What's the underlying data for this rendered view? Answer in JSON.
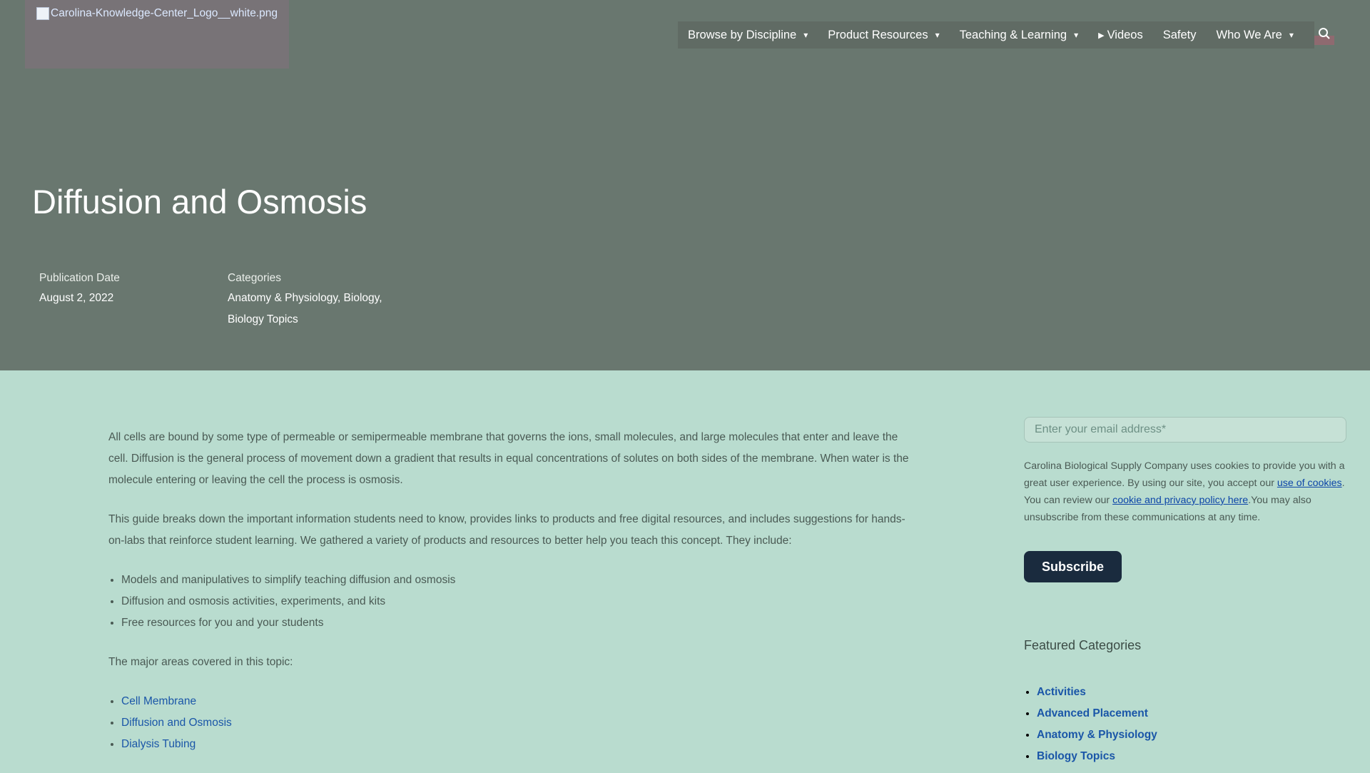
{
  "header": {
    "logo_alt": "Carolina-Knowledge-Center_Logo__white.png",
    "nav": [
      {
        "label": "Browse by Discipline",
        "has_dropdown": true
      },
      {
        "label": "Product Resources",
        "has_dropdown": true
      },
      {
        "label": "Teaching & Learning",
        "has_dropdown": true
      },
      {
        "label": "Videos",
        "has_dropdown": false,
        "icon": "play-icon"
      },
      {
        "label": "Safety",
        "has_dropdown": false
      },
      {
        "label": "Who We Are",
        "has_dropdown": true
      }
    ],
    "search_icon": "search-icon"
  },
  "hero": {
    "title": "Diffusion and Osmosis",
    "publication_date_label": "Publication Date",
    "publication_date": "August 2, 2022",
    "categories_label": "Categories",
    "categories_line1": "Anatomy & Physiology, Biology,",
    "categories_line2": "Biology Topics"
  },
  "article": {
    "p1": "All cells are bound by some type of permeable or semipermeable membrane that governs the ions, small molecules, and large molecules that enter and leave the cell. Diffusion is the general process of movement down a gradient that results in equal concentrations of solutes on both sides of the membrane. When water is the molecule entering or leaving the cell the process is osmosis.",
    "p2": "This guide breaks down the important information students need to know, provides links to products and free digital resources, and includes suggestions for hands-on-labs that reinforce student learning. We gathered a variety of products and resources to better help you teach this concept. They include:",
    "list1": [
      "Models and manipulatives to simplify teaching diffusion and osmosis",
      "Diffusion and osmosis activities, experiments, and kits",
      "Free resources for you and your students"
    ],
    "p3": "The major areas covered in this topic:",
    "topics": [
      "Cell Membrane",
      "Diffusion and Osmosis",
      "Dialysis Tubing"
    ]
  },
  "sidebar": {
    "email_placeholder": "Enter your email address*",
    "cookie_text_1": "Carolina Biological Supply Company uses cookies to provide you with a great user experience. By using our site, you accept our ",
    "cookie_link_1": "use of cookies",
    "cookie_text_2": ". You can review our ",
    "cookie_link_2": "cookie and privacy policy here",
    "cookie_text_3": ".You may also unsubscribe from these communications at any time.",
    "subscribe_label": "Subscribe",
    "featured_title": "Featured Categories",
    "featured": [
      "Activities",
      "Advanced Placement",
      "Anatomy & Physiology",
      "Biology Topics"
    ]
  }
}
